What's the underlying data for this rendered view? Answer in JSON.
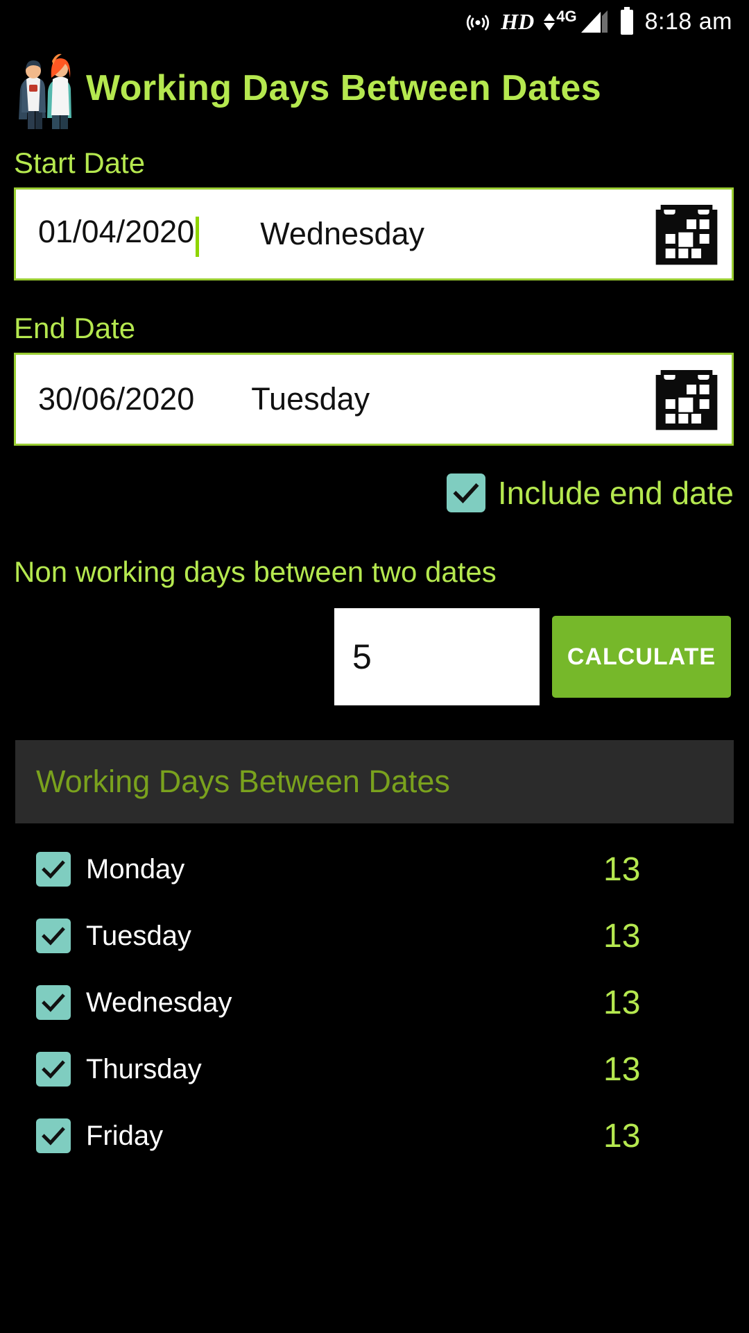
{
  "statusbar": {
    "hotspot_icon": "hotspot-icon",
    "hd_label": "HD",
    "network_label": "4G",
    "signal_icon": "signal-bars-icon",
    "battery_icon": "battery-icon",
    "time": "8:18 am"
  },
  "header": {
    "logo_icon": "couple-illustration-icon",
    "title": "Working Days Between Dates",
    "title_color": "#b5e84f"
  },
  "start_date": {
    "label": "Start Date",
    "value": "01/04/2020",
    "weekday": "Wednesday",
    "calendar_icon": "calendar-icon"
  },
  "end_date": {
    "label": "End Date",
    "value": "30/06/2020",
    "weekday": "Tuesday",
    "calendar_icon": "calendar-icon"
  },
  "include_end_date": {
    "label": "Include end date",
    "checked": true,
    "check_icon": "check-icon"
  },
  "non_working": {
    "label": "Non working days between two dates",
    "value": "5",
    "calculate_label": "CALCULATE",
    "button_color": "#76b82a"
  },
  "results": {
    "header": "Working Days Between Dates",
    "rows": [
      {
        "day": "Monday",
        "count": "13",
        "checked": true
      },
      {
        "day": "Tuesday",
        "count": "13",
        "checked": true
      },
      {
        "day": "Wednesday",
        "count": "13",
        "checked": true
      },
      {
        "day": "Thursday",
        "count": "13",
        "checked": true
      },
      {
        "day": "Friday",
        "count": "13",
        "checked": true
      }
    ]
  },
  "colors": {
    "accent_green": "#b5e84f",
    "button_green": "#76b82a",
    "checkbox_teal": "#7fcdc0",
    "background": "#000000",
    "results_header_bg": "#2b2b2b",
    "results_header_text": "#7aa21d"
  }
}
